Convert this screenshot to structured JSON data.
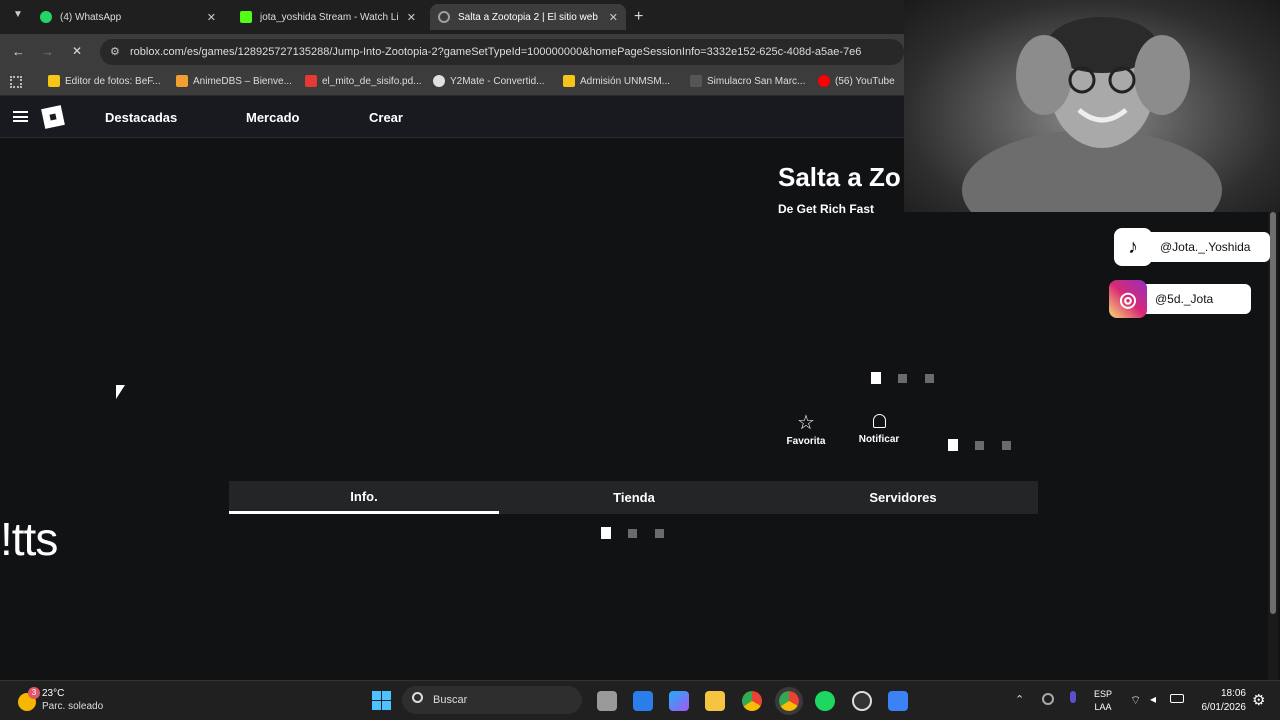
{
  "browser": {
    "tabs": [
      {
        "title": "(4) WhatsApp",
        "color": "#25d366"
      },
      {
        "title": "jota_yoshida Stream - Watch Li",
        "color": "#53fc18"
      },
      {
        "title": "Salta a Zootopia 2 | El sitio web",
        "color": "#9aa0a6"
      }
    ],
    "url": "roblox.com/es/games/128925727135288/Jump-Into-Zootopia-2?gameSetTypeId=100000000&homePageSessionInfo=3332e152-625c-408d-a5ae-7e6",
    "bookmarks": [
      {
        "label": "Editor de fotos: BeF...",
        "color": "#f5c518"
      },
      {
        "label": "AnimeDBS – Bienve...",
        "color": "#f0a030"
      },
      {
        "label": "el_mito_de_sisifo.pd...",
        "color": "#e53935"
      },
      {
        "label": "Y2Mate - Convertid...",
        "color": "#e0e0e0"
      },
      {
        "label": "Admisión UNMSM...",
        "color": "#f5c518"
      },
      {
        "label": "Simulacro San Marc...",
        "color": "#222"
      },
      {
        "label": "(56) YouTube",
        "color": "#ff0000"
      }
    ]
  },
  "roblox": {
    "nav": {
      "featured": "Destacadas",
      "market": "Mercado",
      "create": "Crear"
    },
    "game": {
      "title": "Salta a Zo",
      "creator": "De Get Rich Fast"
    },
    "actions": {
      "favorite": "Favorita",
      "notify": "Notificar"
    },
    "tabs": {
      "info": "Info.",
      "store": "Tienda",
      "servers": "Servidores"
    }
  },
  "overlay": {
    "tiktok": "@Jota._.Yoshida",
    "instagram": "@5d._Jota",
    "side_text": "!tts"
  },
  "taskbar": {
    "weather_temp": "23°C",
    "weather_desc": "Parc. soleado",
    "weather_badge": "3",
    "search": "Buscar",
    "lang": "ESP",
    "lang2": "LAA",
    "time": "18:06",
    "date": "6/01/2026"
  }
}
